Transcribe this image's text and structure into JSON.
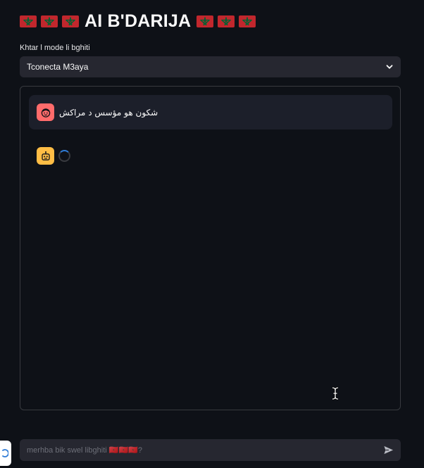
{
  "header": {
    "title": "AI B'DARIJA",
    "flag_icon": "morocco-flag-icon",
    "flag_count_each_side": 3
  },
  "model_select": {
    "label": "Khtar l mode li bghiti",
    "selected": "Tconecta M3aya"
  },
  "chat": {
    "messages": [
      {
        "role": "user",
        "avatar_icon": "user-face-icon",
        "text": "شكون هو مؤسس د مراكش"
      },
      {
        "role": "assistant",
        "avatar_icon": "robot-icon",
        "status": "loading"
      }
    ]
  },
  "chat_input": {
    "placeholder": "merhba bik swel libghiti 🇲🇦🇲🇦🇲🇦?",
    "send_icon": "send-icon"
  },
  "colors": {
    "background": "#0e1117",
    "surface": "#262730",
    "user_avatar": "#ff6b6b",
    "bot_avatar": "#ffbd45",
    "flag_red": "#c1272d",
    "flag_green": "#006233"
  }
}
